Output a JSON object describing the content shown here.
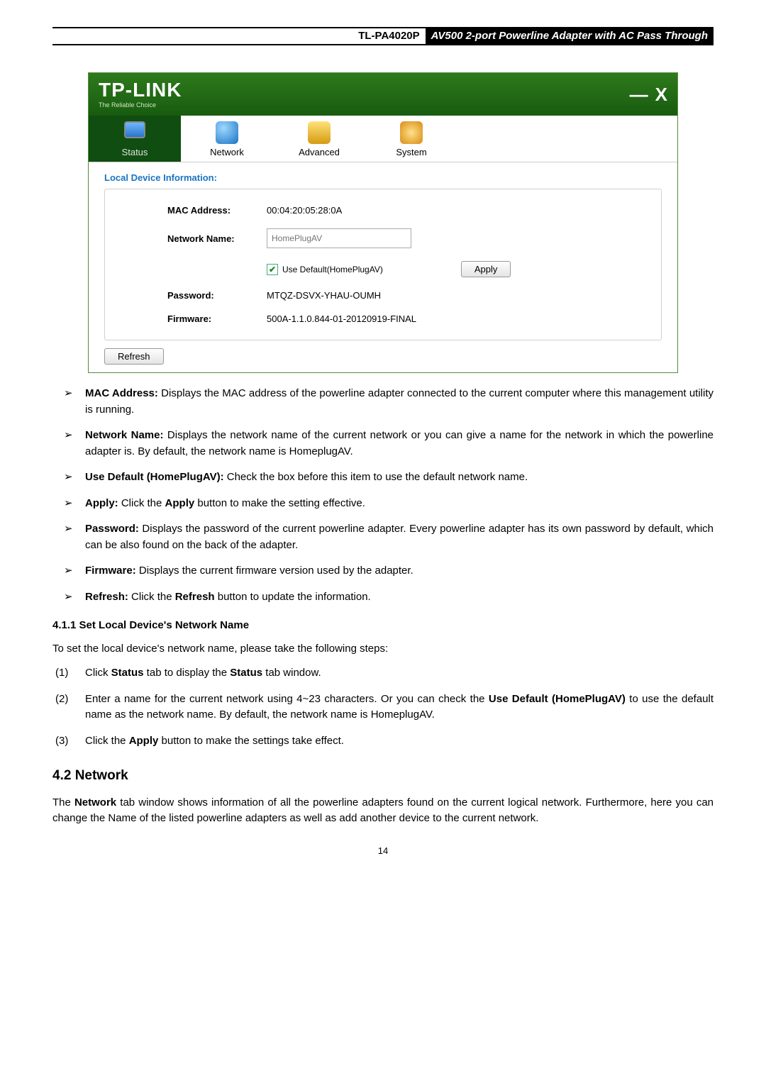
{
  "header": {
    "model": "TL-PA4020P",
    "title": "AV500 2-port Powerline Adapter with AC Pass Through"
  },
  "shot": {
    "logo": "TP-LINK",
    "slogan": "The Reliable Choice",
    "tabs": {
      "status": "Status",
      "network": "Network",
      "advanced": "Advanced",
      "system": "System"
    },
    "section_title": "Local Device Information:",
    "lab_mac": "MAC  Address:",
    "val_mac": "00:04:20:05:28:0A",
    "lab_net": "Network Name:",
    "ph_net": "HomePlugAV",
    "chk_label": "Use Default(HomePlugAV)",
    "apply": "Apply",
    "lab_pwd": "Password:",
    "val_pwd": "MTQZ-DSVX-YHAU-OUMH",
    "lab_fw": "Firmware:",
    "val_fw": "500A-1.1.0.844-01-20120919-FINAL",
    "refresh": "Refresh"
  },
  "bullets": {
    "mac": {
      "t": "MAC Address:",
      "d": " Displays the MAC address of the powerline adapter connected to the current computer where this management utility is running."
    },
    "net": {
      "t": "Network Name:",
      "d": " Displays the network name of the current network or you can give a name for the network in which the powerline adapter is. By default, the network name is HomeplugAV."
    },
    "def": {
      "t": "Use Default (HomePlugAV):",
      "d": " Check the box before this item to use the default network name."
    },
    "apply": {
      "t": "Apply:",
      "mid": " Click the ",
      "b2": "Apply",
      "d": " button to make the setting effective."
    },
    "pwd": {
      "t": "Password:",
      "d": " Displays the password of the current powerline adapter. Every powerline adapter has its own password by default, which can be also found on the back of the adapter."
    },
    "fw": {
      "t": "Firmware:",
      "d": " Displays the current firmware version used by the adapter."
    },
    "ref": {
      "t": "Refresh:",
      "mid": " Click the ",
      "b2": "Refresh",
      "d": " button to update the information."
    }
  },
  "s411": {
    "h": "4.1.1 Set Local Device's Network Name",
    "intro": "To set the local device's network name, please take the following steps:"
  },
  "steps": {
    "s1": {
      "n": "(1)",
      "a": "Click ",
      "b1": "Status",
      "b": " tab to display the ",
      "b2": "Status",
      "c": " tab window."
    },
    "s2": {
      "n": "(2)",
      "a": "Enter a name for the current network using 4~23 characters. Or you can check the ",
      "b1": "Use Default (HomePlugAV)",
      "b": " to use the default name as the network name. By default, the network name is HomeplugAV."
    },
    "s3": {
      "n": "(3)",
      "a": "Click the ",
      "b1": "Apply",
      "b": " button to make the settings take effect."
    }
  },
  "s42": {
    "h": "4.2 Network",
    "p1a": "The ",
    "p1b": "Network",
    "p1c": " tab window shows information of all the powerline adapters found on the current logical network. Furthermore, here you can change the Name of the listed powerline adapters as well as add another device to the current network."
  },
  "page": "14"
}
